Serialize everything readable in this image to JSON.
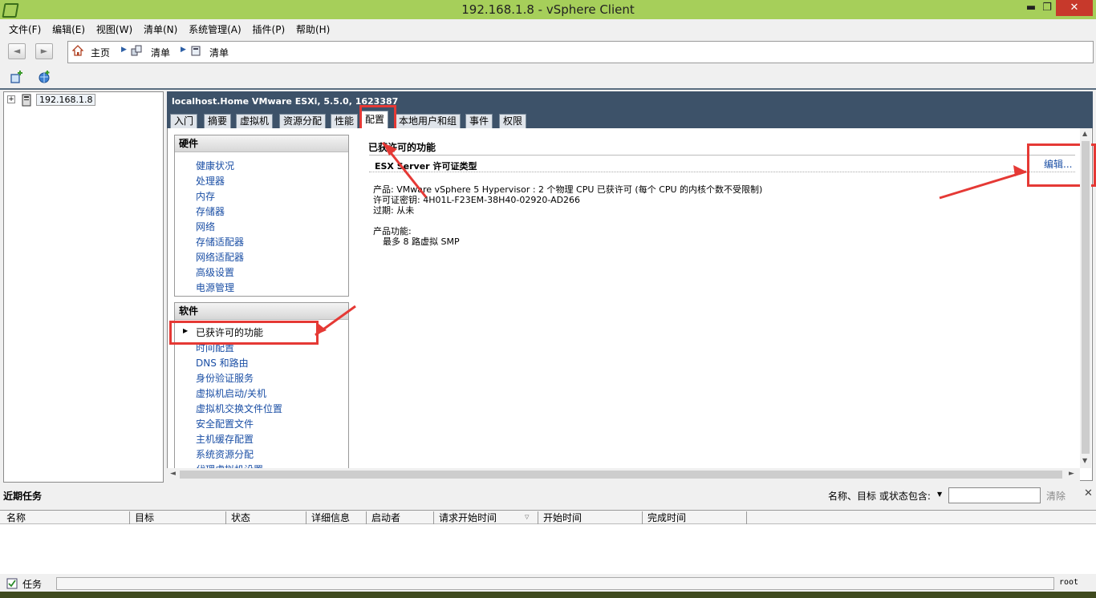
{
  "window": {
    "title": "192.168.1.8 - vSphere Client",
    "min": "▬",
    "restore": "❐",
    "close": "✕"
  },
  "menu": [
    "文件(F)",
    "编辑(E)",
    "视图(W)",
    "清单(N)",
    "系统管理(A)",
    "插件(P)",
    "帮助(H)"
  ],
  "nav": {
    "back": "◄",
    "forward": "►",
    "crumbs": [
      "主页",
      "清单",
      "清单"
    ]
  },
  "tree": {
    "expander": "+",
    "host": "192.168.1.8"
  },
  "header": {
    "host_title": "localhost.Home VMware ESXi, 5.5.0, 1623387"
  },
  "tabs": [
    "入门",
    "摘要",
    "虚拟机",
    "资源分配",
    "性能",
    "配置",
    "本地用户和组",
    "事件",
    "权限"
  ],
  "active_tab": "配置",
  "hardware": {
    "title": "硬件",
    "items": [
      "健康状况",
      "处理器",
      "内存",
      "存储器",
      "网络",
      "存储适配器",
      "网络适配器",
      "高级设置",
      "电源管理"
    ]
  },
  "software": {
    "title": "软件",
    "selected": "已获许可的功能",
    "items": [
      "时间配置",
      "DNS 和路由",
      "身份验证服务",
      "虚拟机启动/关机",
      "虚拟机交换文件位置",
      "安全配置文件",
      "主机缓存配置",
      "系统资源分配",
      "代理虚拟机设置"
    ]
  },
  "details": {
    "section_title": "已获许可的功能",
    "subsection": "ESX Server 许可证类型",
    "edit_link": "编辑...",
    "product": "产品: VMware vSphere 5 Hypervisor : 2 个物理 CPU 已获许可 (每个 CPU 的内核个数不受限制)",
    "license_key": "许可证密钥: 4H01L-F23EM-38H40-02920-AD266",
    "expires": "过期: 从未",
    "features_label": "产品功能:",
    "features": [
      "最多 8 路虚拟 SMP"
    ]
  },
  "tasks": {
    "title": "近期任务",
    "filter_label": "名称、目标 或状态包含:",
    "filter_value": "",
    "clear": "清除",
    "close": "✕",
    "columns": [
      "名称",
      "目标",
      "状态",
      "详细信息",
      "启动者",
      "请求开始时间",
      "开始时间",
      "完成时间"
    ]
  },
  "statusbar": {
    "tasks_label": "任务",
    "user": "root"
  }
}
